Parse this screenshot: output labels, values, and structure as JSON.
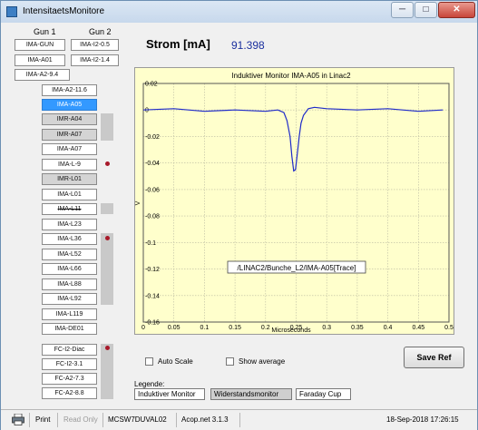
{
  "window": {
    "title": "IntensitaetsMonitore",
    "controls": {
      "minimize": "─",
      "maximize": "□",
      "close": "✕"
    }
  },
  "sidebar": {
    "gun1_header": "Gun 1",
    "gun2_header": "Gun 2",
    "gun_buttons": [
      "IMA-GUN",
      "IMA-I2-0.5",
      "IMA-A01",
      "IMA-I2-1.4",
      "IMA-A2-9.4"
    ],
    "monitors": [
      "IMA-A2-11.6",
      "IMA-A05",
      "IMR-A04",
      "IMR-A07",
      "IMA-A07",
      "IMA-L-9",
      "IMR-L01",
      "IMA-L01",
      "IMA-L11",
      "IMA-L23",
      "IMA-L36",
      "IMA-L52",
      "IMA-L66",
      "IMA-L88",
      "IMA-L92",
      "IMA-L119",
      "IMA-DE01"
    ],
    "selected": "IMA-A05",
    "fc_buttons": [
      "FC-I2-Diac",
      "FC-I2-3.1",
      "FC-A2-7.3",
      "FC-A2-8.8"
    ]
  },
  "readout": {
    "label": "Strom [mA]",
    "value": "91.398"
  },
  "plot": {
    "tooltip": "/LINAC2/Bunche_L2/IMA-A05[Trace]"
  },
  "chart_data": {
    "type": "line",
    "title": "Induktiver Monitor IMA-A05 in Linac2",
    "xlabel": "Microseconds",
    "ylabel": "V",
    "xlim": [
      0,
      0.5
    ],
    "ylim": [
      -0.16,
      0.02
    ],
    "x_ticks": [
      "0",
      "0.05",
      "0.1",
      "0.15",
      "0.2",
      "0.25",
      "0.3",
      "0.35",
      "0.4",
      "0.45",
      "0.5"
    ],
    "y_ticks": [
      "0.02",
      "0",
      "-0.02",
      "-0.04",
      "-0.06",
      "-0.08",
      "-0.1",
      "-0.12",
      "-0.14",
      "-0.16"
    ],
    "grid": true,
    "series": [
      {
        "color": "#1f2bc9",
        "x": [
          0,
          0.05,
          0.1,
          0.15,
          0.2,
          0.22,
          0.23,
          0.235,
          0.24,
          0.243,
          0.246,
          0.249,
          0.252,
          0.255,
          0.258,
          0.262,
          0.27,
          0.28,
          0.3,
          0.35,
          0.4,
          0.45,
          0.49
        ],
        "y": [
          0,
          0.001,
          -0.001,
          0,
          -0.001,
          0,
          -0.002,
          -0.008,
          -0.02,
          -0.035,
          -0.046,
          -0.045,
          -0.033,
          -0.02,
          -0.01,
          -0.004,
          0.001,
          0.002,
          0.001,
          0,
          0.001,
          -0.001,
          0
        ]
      }
    ]
  },
  "options": {
    "auto_scale": "Auto Scale",
    "show_average": "Show average"
  },
  "save_button": "Save Ref",
  "legend": {
    "label": "Legende:",
    "items": [
      "Induktiver Monitor",
      "Widerstandsmonitor",
      "Faraday Cup"
    ]
  },
  "status": {
    "print": "Print",
    "read_only": "Read Only",
    "host": "MCSW7DUVAL02",
    "version": "Acop.net 3.1.3",
    "datetime": "18-Sep-2018 17:26:15"
  }
}
